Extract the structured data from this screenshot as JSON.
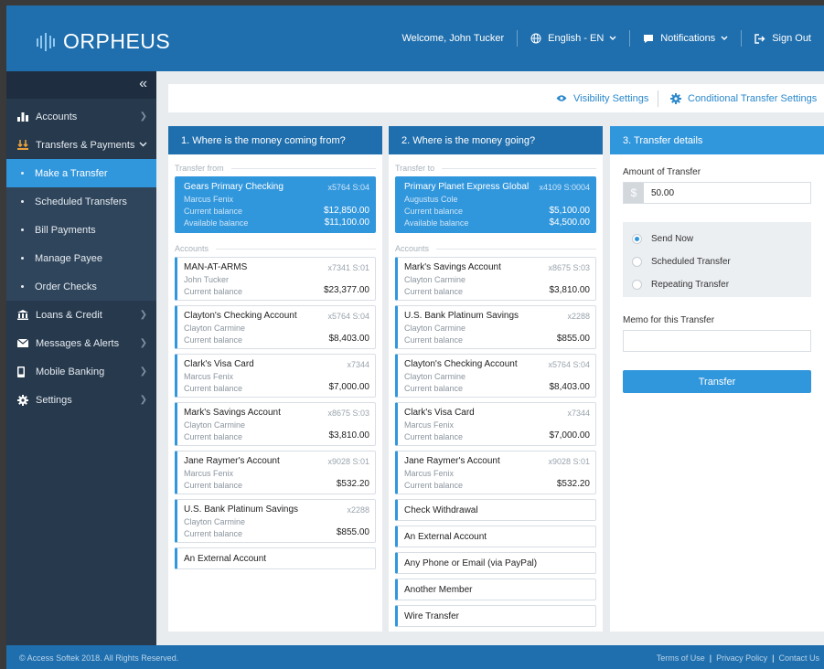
{
  "header": {
    "brand": "ORPHEUS",
    "welcome": "Welcome, John Tucker",
    "language": "English - EN",
    "notifications": "Notifications",
    "signout": "Sign Out"
  },
  "sidebar": {
    "collapse_icon": "«",
    "items": [
      {
        "label": "Accounts",
        "icon": "bar-chart-icon"
      },
      {
        "label": "Transfers & Payments",
        "icon": "transfer-icon"
      },
      {
        "label": "Loans & Credit",
        "icon": "bank-icon"
      },
      {
        "label": "Messages & Alerts",
        "icon": "envelope-icon"
      },
      {
        "label": "Mobile Banking",
        "icon": "mobile-icon"
      },
      {
        "label": "Settings",
        "icon": "gear-icon"
      }
    ],
    "subitems": [
      "Make a Transfer",
      "Scheduled Transfers",
      "Bill Payments",
      "Manage Payee",
      "Order Checks"
    ]
  },
  "toolbar": {
    "visibility": "Visibility Settings",
    "conditional": "Conditional Transfer Settings"
  },
  "from": {
    "title": "1. Where is the money coming from?",
    "selected_label": "Transfer from",
    "accounts_label": "Accounts",
    "selected": {
      "name": "Gears Primary Checking",
      "num": "x5764 S:04",
      "owner": "Marcus Fenix",
      "l1": "Current balance",
      "v1": "$12,850.00",
      "l2": "Available balance",
      "v2": "$11,100.00"
    },
    "cards": [
      {
        "name": "MAN-AT-ARMS",
        "num": "x7341 S:01",
        "owner": "John Tucker",
        "bl": "Current balance",
        "bal": "$23,377.00"
      },
      {
        "name": "Clayton's Checking Account",
        "num": "x5764 S:04",
        "owner": "Clayton Carmine",
        "bl": "Current balance",
        "bal": "$8,403.00"
      },
      {
        "name": "Clark's Visa Card",
        "num": "x7344",
        "owner": "Marcus Fenix",
        "bl": "Current balance",
        "bal": "$7,000.00"
      },
      {
        "name": "Mark's Savings Account",
        "num": "x8675 S:03",
        "owner": "Clayton Carmine",
        "bl": "Current balance",
        "bal": "$3,810.00"
      },
      {
        "name": "Jane Raymer's Account",
        "num": "x9028 S:01",
        "owner": "Marcus Fenix",
        "bl": "Current balance",
        "bal": "$532.20"
      },
      {
        "name": "U.S. Bank Platinum Savings",
        "num": "x2288",
        "owner": "Clayton Carmine",
        "bl": "Current balance",
        "bal": "$855.00"
      }
    ],
    "external": "An External Account"
  },
  "to": {
    "title": "2. Where is the money going?",
    "selected_label": "Transfer to",
    "accounts_label": "Accounts",
    "selected": {
      "name": "Primary Planet Express Global",
      "num": "x4109 S:0004",
      "owner": "Augustus Cole",
      "l1": "Current balance",
      "v1": "$5,100.00",
      "l2": "Available balance",
      "v2": "$4,500.00"
    },
    "cards": [
      {
        "name": "Mark's Savings Account",
        "num": "x8675 S:03",
        "owner": "Clayton Carmine",
        "bl": "Current balance",
        "bal": "$3,810.00"
      },
      {
        "name": "U.S. Bank Platinum Savings",
        "num": "x2288",
        "owner": "Clayton Carmine",
        "bl": "Current balance",
        "bal": "$855.00"
      },
      {
        "name": "Clayton's Checking Account",
        "num": "x5764 S:04",
        "owner": "Clayton Carmine",
        "bl": "Current balance",
        "bal": "$8,403.00"
      },
      {
        "name": "Clark's Visa Card",
        "num": "x7344",
        "owner": "Marcus Fenix",
        "bl": "Current balance",
        "bal": "$7,000.00"
      },
      {
        "name": "Jane Raymer's Account",
        "num": "x9028 S:01",
        "owner": "Marcus Fenix",
        "bl": "Current balance",
        "bal": "$532.20"
      }
    ],
    "options": [
      "Check Withdrawal",
      "An External Account",
      "Any Phone or Email (via PayPal)",
      "Another Member",
      "Wire Transfer"
    ]
  },
  "details": {
    "title": "3. Transfer details",
    "amount_label": "Amount of Transfer",
    "currency": "$",
    "amount": "50.00",
    "radios": [
      "Send Now",
      "Scheduled Transfer",
      "Repeating Transfer"
    ],
    "selected_radio": "Send Now",
    "memo_label": "Memo for this Transfer",
    "memo": "",
    "button": "Transfer"
  },
  "footer": {
    "copyright": "© Access Softek 2018. All Rights Reserved.",
    "terms": "Terms of Use",
    "privacy": "Privacy Policy",
    "contact": "Contact Us",
    "sep": "|"
  },
  "colors": {
    "header": "#1f6fae",
    "accent": "#3197dd",
    "sidebar": "#27394d"
  }
}
